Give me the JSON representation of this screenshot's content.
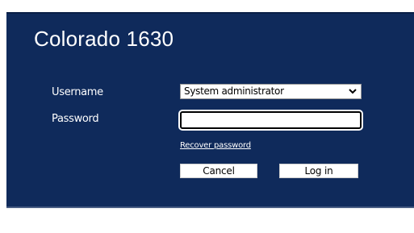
{
  "app": {
    "title": "Colorado 1630"
  },
  "form": {
    "username_label": "Username",
    "username_selected": "System administrator",
    "password_label": "Password",
    "password_value": "",
    "recover_link": "Recover password",
    "cancel_label": "Cancel",
    "login_label": "Log in"
  },
  "icons": {
    "select_arrow": "chevron-down-icon"
  },
  "colors": {
    "panel_background": "#0f2a5b",
    "text_on_panel": "#ffffff"
  }
}
